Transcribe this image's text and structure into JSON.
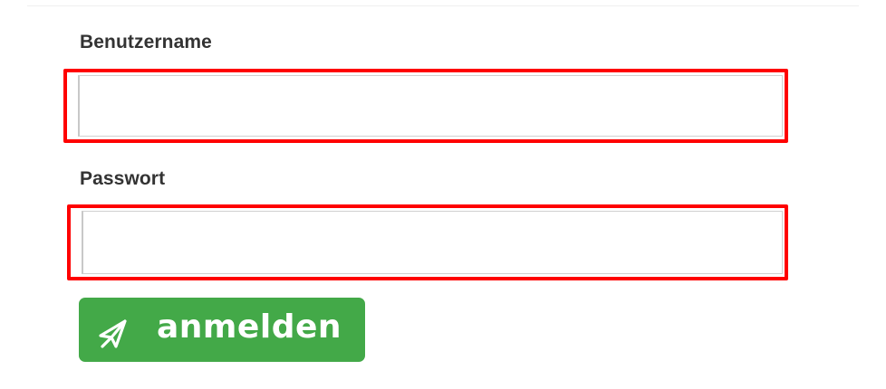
{
  "form": {
    "username_label": "Benutzername",
    "username_value": "",
    "password_label": "Passwort",
    "password_value": "",
    "submit_label": "anmelden",
    "submit_icon": "paper-plane-icon"
  },
  "colors": {
    "highlight_border": "#ff0000",
    "button_background": "#43a948",
    "button_text": "#ffffff",
    "label_text": "#333333"
  }
}
